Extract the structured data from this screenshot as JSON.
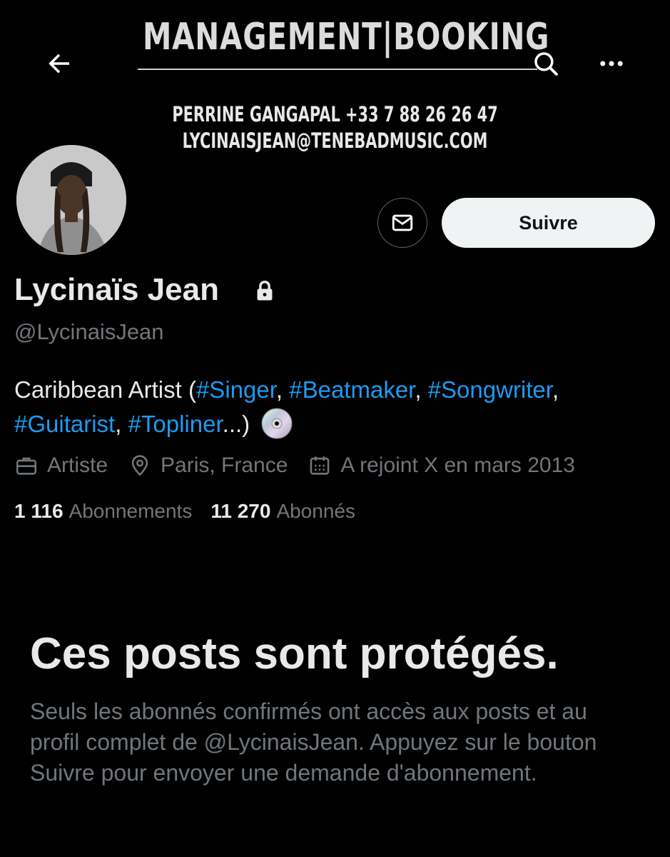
{
  "banner": {
    "title": "MANAGEMENT|BOOKING",
    "contact_line_1": "PERRINE GANGAPAL +33 7 88 26 26 47",
    "contact_line_2": "LYCINAISJEAN@TENEBADMUSIC.COM"
  },
  "nav": {
    "back_icon": "arrow-left-icon",
    "search_icon": "search-icon",
    "more_icon": "more-horizontal-icon"
  },
  "profile": {
    "display_name": "Lycinaïs Jean",
    "handle": "@LycinaisJean",
    "follow_label": "Suivre",
    "message_icon": "envelope-icon",
    "locked": true
  },
  "bio": {
    "prefix": "Caribbean Artist (",
    "tags": [
      "#Singer",
      "#Beatmaker",
      "#Songwriter",
      "#Guitarist",
      "#Topliner"
    ],
    "sep": ", ",
    "ellipsis": "...)",
    "emoji_icon": "cd-icon"
  },
  "meta": {
    "category": "Artiste",
    "location": "Paris, France",
    "joined": "A rejoint X en mars 2013"
  },
  "counts": {
    "following_value": "1 116",
    "following_label": "Abonnements",
    "followers_value": "11 270",
    "followers_label": "Abonnés"
  },
  "protected": {
    "title": "Ces posts sont protégés.",
    "description": "Seuls les abonnés confirmés ont accès aux posts et au profil complet de @LycinaisJean. Appuyez sur le bouton Suivre pour envoyer une demande d'abonnement."
  },
  "colors": {
    "background": "#000000",
    "text_primary": "#e7e9ea",
    "text_secondary": "#71767b",
    "link": "#1d9bf0",
    "button_bg": "#eff3f4"
  }
}
